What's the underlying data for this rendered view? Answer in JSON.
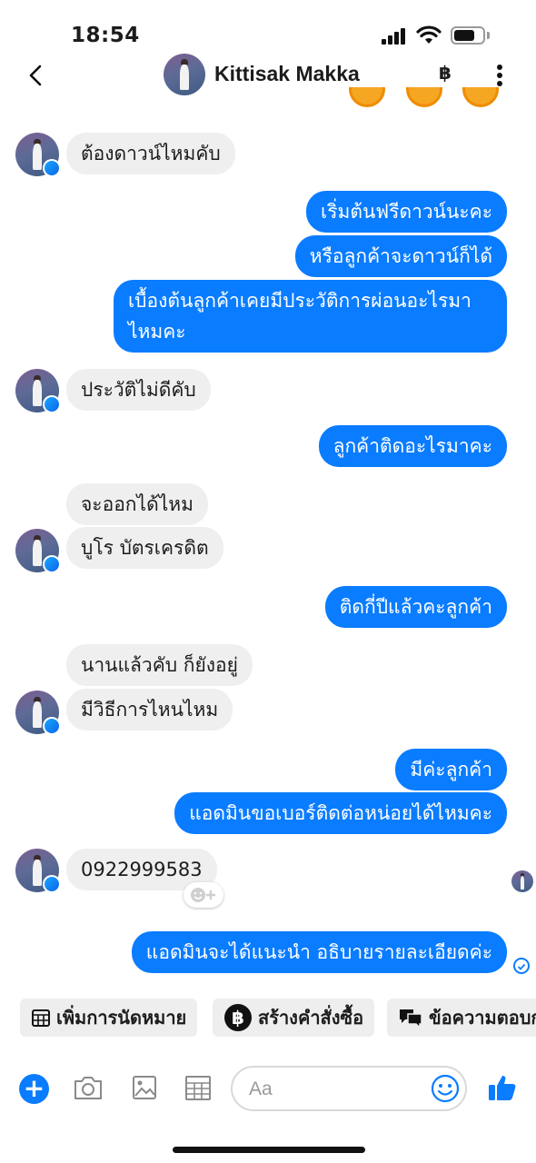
{
  "status_bar": {
    "time": "18:54"
  },
  "header": {
    "contact_name": "Kittisak Makka",
    "currency_icon": "฿"
  },
  "messages": [
    {
      "side": "in",
      "text": "ต้องดาวน์ไหมคับ"
    },
    {
      "side": "out",
      "text": "เริ่มต้นฟรีดาวน์นะคะ"
    },
    {
      "side": "out",
      "text": "หรือลูกค้าจะดาวน์ก็ได้"
    },
    {
      "side": "out",
      "text": "เบื้องต้นลูกค้าเคยมีประวัติการผ่อนอะไรมาไหมคะ"
    },
    {
      "side": "in",
      "text": "ประวัติไม่ดีคับ"
    },
    {
      "side": "out",
      "text": "ลูกค้าติดอะไรมาคะ"
    },
    {
      "side": "in",
      "text": "จะออกได้ไหม"
    },
    {
      "side": "in",
      "text": "บูโร บัตรเครดิต"
    },
    {
      "side": "out",
      "text": "ติดกี่ปีแล้วคะลูกค้า"
    },
    {
      "side": "in",
      "text": "นานแล้วคับ ก็ยังอยู่"
    },
    {
      "side": "in",
      "text": "มีวิธีการไหนไหม"
    },
    {
      "side": "out",
      "text": "มีค่ะลูกค้า"
    },
    {
      "side": "out",
      "text": "แอดมินขอเบอร์ติดต่อหน่อยได้ไหมคะ"
    },
    {
      "side": "in",
      "text": "0922999583"
    },
    {
      "side": "out",
      "text": "แอดมินจะได้แนะนำ อธิบายรายละเอียดค่ะ"
    }
  ],
  "quick_actions": [
    {
      "label": "เพิ่มการนัดหมาย",
      "icon": "calendar-icon"
    },
    {
      "label": "สร้างคำสั่งซื้อ",
      "icon": "baht-icon"
    },
    {
      "label": "ข้อความตอบก",
      "icon": "chat-bubbles-icon"
    }
  ],
  "composer": {
    "placeholder": "Aa"
  },
  "colors": {
    "accent": "#0a7cff",
    "incoming_bubble": "#efefef",
    "chip_bg": "#eeeeee"
  }
}
